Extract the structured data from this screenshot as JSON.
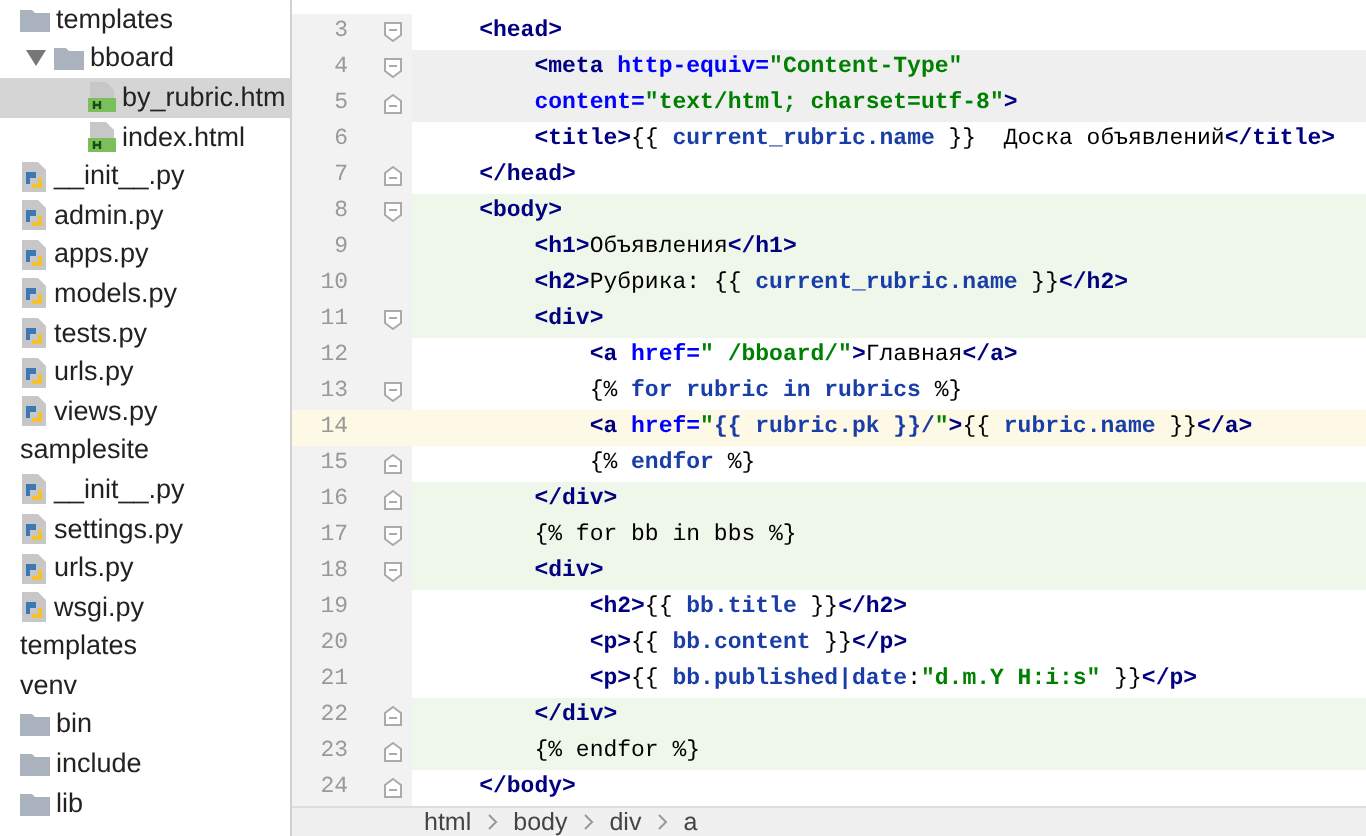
{
  "project_tree": [
    {
      "label": "templates",
      "kind": "folder",
      "expanded": false,
      "selected": false,
      "children": [
        {
          "label": "bboard",
          "kind": "folder",
          "expanded": true,
          "selected": false,
          "children": [
            {
              "label": "by_rubric.htm",
              "kind": "html",
              "expanded": false,
              "selected": true
            },
            {
              "label": "index.html",
              "kind": "html",
              "expanded": false,
              "selected": false
            }
          ]
        }
      ]
    },
    {
      "label": "__init__.py",
      "kind": "python",
      "expanded": false,
      "selected": false
    },
    {
      "label": "admin.py",
      "kind": "python",
      "expanded": false,
      "selected": false
    },
    {
      "label": "apps.py",
      "kind": "python",
      "expanded": false,
      "selected": false
    },
    {
      "label": "models.py",
      "kind": "python",
      "expanded": false,
      "selected": false
    },
    {
      "label": "tests.py",
      "kind": "python",
      "expanded": false,
      "selected": false
    },
    {
      "label": "urls.py",
      "kind": "python",
      "expanded": false,
      "selected": false
    },
    {
      "label": "views.py",
      "kind": "python",
      "expanded": false,
      "selected": false
    },
    {
      "label": "samplesite",
      "kind": "plain",
      "expanded": false,
      "selected": false
    },
    {
      "label": "__init__.py",
      "kind": "python",
      "expanded": false,
      "selected": false
    },
    {
      "label": "settings.py",
      "kind": "python",
      "expanded": false,
      "selected": false
    },
    {
      "label": "urls.py",
      "kind": "python",
      "expanded": false,
      "selected": false
    },
    {
      "label": "wsgi.py",
      "kind": "python",
      "expanded": false,
      "selected": false
    },
    {
      "label": "templates",
      "kind": "plain",
      "expanded": false,
      "selected": false
    },
    {
      "label": "venv",
      "kind": "plain",
      "expanded": false,
      "selected": false
    },
    {
      "label": "bin",
      "kind": "folder",
      "expanded": false,
      "selected": false
    },
    {
      "label": "include",
      "kind": "folder",
      "expanded": false,
      "selected": false
    },
    {
      "label": "lib",
      "kind": "folder",
      "expanded": false,
      "selected": false
    }
  ],
  "editor": {
    "lines": [
      {
        "number": "3",
        "changed": false,
        "caret_line": false,
        "tag_match": false,
        "fold_open": true,
        "fold_close": false,
        "tokens": [
          {
            "kind": "tag",
            "text": "    <head>"
          }
        ]
      },
      {
        "number": "4",
        "changed": false,
        "caret_line": false,
        "tag_match": true,
        "fold_open": true,
        "fold_close": false,
        "tokens": [
          {
            "kind": "tag",
            "text": "        <meta"
          },
          {
            "kind": "attr",
            "text": " http-equiv="
          },
          {
            "kind": "string",
            "text": "\"Content-Type\""
          }
        ]
      },
      {
        "number": "5",
        "changed": false,
        "caret_line": false,
        "tag_match": true,
        "fold_open": false,
        "fold_close": true,
        "tokens": [
          {
            "kind": "attr",
            "text": "        content="
          },
          {
            "kind": "string",
            "text": "\"text/html; charset=utf-8\""
          },
          {
            "kind": "tag",
            "text": ">"
          }
        ]
      },
      {
        "number": "6",
        "changed": false,
        "caret_line": false,
        "tag_match": false,
        "fold_open": false,
        "fold_close": false,
        "tokens": [
          {
            "kind": "tag",
            "text": "        <title>"
          },
          {
            "kind": "text",
            "text": "{{ "
          },
          {
            "kind": "var",
            "text": "current_rubric.name"
          },
          {
            "kind": "text",
            "text": " }}  Доска объявлений"
          },
          {
            "kind": "tag",
            "text": "</title>"
          }
        ]
      },
      {
        "number": "7",
        "changed": false,
        "caret_line": false,
        "tag_match": false,
        "fold_open": false,
        "fold_close": true,
        "tokens": [
          {
            "kind": "tag",
            "text": "    </head>"
          }
        ]
      },
      {
        "number": "8",
        "changed": true,
        "caret_line": false,
        "tag_match": false,
        "fold_open": true,
        "fold_close": false,
        "tokens": [
          {
            "kind": "tag",
            "text": "    <body>"
          }
        ]
      },
      {
        "number": "9",
        "changed": true,
        "caret_line": false,
        "tag_match": false,
        "fold_open": false,
        "fold_close": false,
        "tokens": [
          {
            "kind": "tag",
            "text": "        <h1>"
          },
          {
            "kind": "text",
            "text": "Объявления"
          },
          {
            "kind": "tag",
            "text": "</h1>"
          }
        ]
      },
      {
        "number": "10",
        "changed": true,
        "caret_line": false,
        "tag_match": false,
        "fold_open": false,
        "fold_close": false,
        "tokens": [
          {
            "kind": "tag",
            "text": "        <h2>"
          },
          {
            "kind": "text",
            "text": "Рубрика: {{ "
          },
          {
            "kind": "var",
            "text": "current_rubric.name"
          },
          {
            "kind": "text",
            "text": " }}"
          },
          {
            "kind": "tag",
            "text": "</h2>"
          }
        ]
      },
      {
        "number": "11",
        "changed": true,
        "caret_line": false,
        "tag_match": false,
        "fold_open": true,
        "fold_close": false,
        "tokens": [
          {
            "kind": "tag",
            "text": "        <div>"
          }
        ]
      },
      {
        "number": "12",
        "changed": false,
        "caret_line": false,
        "tag_match": false,
        "fold_open": false,
        "fold_close": false,
        "tokens": [
          {
            "kind": "tag",
            "text": "            <a"
          },
          {
            "kind": "attr",
            "text": " href="
          },
          {
            "kind": "string",
            "text": "\" /bboard/\""
          },
          {
            "kind": "tag",
            "text": ">"
          },
          {
            "kind": "text",
            "text": "Главная"
          },
          {
            "kind": "tag",
            "text": "</a>"
          }
        ]
      },
      {
        "number": "13",
        "changed": false,
        "caret_line": false,
        "tag_match": false,
        "fold_open": true,
        "fold_close": false,
        "tokens": [
          {
            "kind": "text",
            "text": "            {% "
          },
          {
            "kind": "var",
            "text": "for rubric in rubrics"
          },
          {
            "kind": "text",
            "text": " %}"
          }
        ]
      },
      {
        "number": "14",
        "changed": false,
        "caret_line": true,
        "tag_match": false,
        "fold_open": false,
        "fold_close": false,
        "tokens": [
          {
            "kind": "tag",
            "text": "            <a"
          },
          {
            "kind": "attr",
            "text": " href="
          },
          {
            "kind": "string",
            "text": "\""
          },
          {
            "kind": "var",
            "text": "{{ rubric.pk }}/"
          },
          {
            "kind": "string",
            "text": "\""
          },
          {
            "kind": "tag",
            "text": ">"
          },
          {
            "kind": "text",
            "text": "{{ "
          },
          {
            "kind": "var",
            "text": "rubric.name"
          },
          {
            "kind": "text",
            "text": " }}"
          },
          {
            "kind": "tag",
            "text": "</a>"
          }
        ]
      },
      {
        "number": "15",
        "changed": false,
        "caret_line": false,
        "tag_match": false,
        "fold_open": false,
        "fold_close": true,
        "tokens": [
          {
            "kind": "text",
            "text": "            {% "
          },
          {
            "kind": "var",
            "text": "endfor"
          },
          {
            "kind": "text",
            "text": " %}"
          }
        ]
      },
      {
        "number": "16",
        "changed": true,
        "caret_line": false,
        "tag_match": false,
        "fold_open": false,
        "fold_close": true,
        "tokens": [
          {
            "kind": "tag",
            "text": "        </div>"
          }
        ]
      },
      {
        "number": "17",
        "changed": true,
        "caret_line": false,
        "tag_match": false,
        "fold_open": true,
        "fold_close": false,
        "tokens": [
          {
            "kind": "text",
            "text": "        {% for bb in bbs %}"
          }
        ]
      },
      {
        "number": "18",
        "changed": true,
        "caret_line": false,
        "tag_match": false,
        "fold_open": true,
        "fold_close": false,
        "tokens": [
          {
            "kind": "tag",
            "text": "        <div>"
          }
        ]
      },
      {
        "number": "19",
        "changed": false,
        "caret_line": false,
        "tag_match": false,
        "fold_open": false,
        "fold_close": false,
        "tokens": [
          {
            "kind": "tag",
            "text": "            <h2>"
          },
          {
            "kind": "text",
            "text": "{{ "
          },
          {
            "kind": "var",
            "text": "bb.title"
          },
          {
            "kind": "text",
            "text": " }}"
          },
          {
            "kind": "tag",
            "text": "</h2>"
          }
        ]
      },
      {
        "number": "20",
        "changed": false,
        "caret_line": false,
        "tag_match": false,
        "fold_open": false,
        "fold_close": false,
        "tokens": [
          {
            "kind": "tag",
            "text": "            <p>"
          },
          {
            "kind": "text",
            "text": "{{ "
          },
          {
            "kind": "var",
            "text": "bb.content"
          },
          {
            "kind": "text",
            "text": " }}"
          },
          {
            "kind": "tag",
            "text": "</p>"
          }
        ]
      },
      {
        "number": "21",
        "changed": false,
        "caret_line": false,
        "tag_match": false,
        "fold_open": false,
        "fold_close": false,
        "tokens": [
          {
            "kind": "tag",
            "text": "            <p>"
          },
          {
            "kind": "text",
            "text": "{{ "
          },
          {
            "kind": "var",
            "text": "bb.published|date"
          },
          {
            "kind": "text",
            "text": ":"
          },
          {
            "kind": "string",
            "text": "\"d.m.Y H:i:s\""
          },
          {
            "kind": "text",
            "text": " }}"
          },
          {
            "kind": "tag",
            "text": "</p>"
          }
        ]
      },
      {
        "number": "22",
        "changed": true,
        "caret_line": false,
        "tag_match": false,
        "fold_open": false,
        "fold_close": true,
        "tokens": [
          {
            "kind": "tag",
            "text": "        </div>"
          }
        ]
      },
      {
        "number": "23",
        "changed": true,
        "caret_line": false,
        "tag_match": false,
        "fold_open": false,
        "fold_close": true,
        "tokens": [
          {
            "kind": "text",
            "text": "        {% endfor %}"
          }
        ]
      },
      {
        "number": "24",
        "changed": false,
        "caret_line": false,
        "tag_match": false,
        "fold_open": false,
        "fold_close": true,
        "tokens": [
          {
            "kind": "tag",
            "text": "    </body>"
          }
        ]
      }
    ]
  },
  "breadcrumbs": [
    "html",
    "body",
    "div",
    "a"
  ]
}
